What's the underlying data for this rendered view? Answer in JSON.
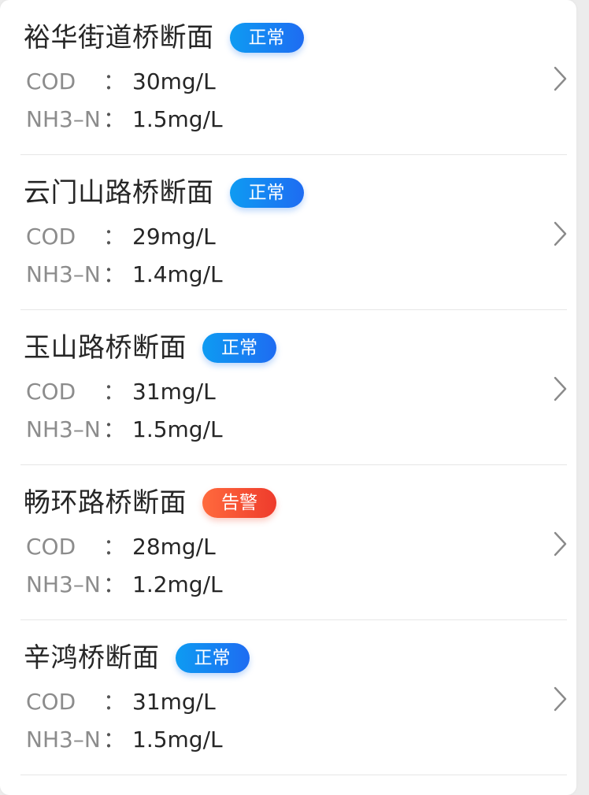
{
  "stations": [
    {
      "name": "裕华街道桥断面",
      "status": "正常",
      "status_type": "normal",
      "metrics": [
        {
          "label": "COD",
          "colon": "：",
          "value": "30mg/L"
        },
        {
          "label": "NH3–N",
          "colon": "：",
          "value": "1.5mg/L"
        }
      ]
    },
    {
      "name": "云门山路桥断面",
      "status": "正常",
      "status_type": "normal",
      "metrics": [
        {
          "label": "COD",
          "colon": "：",
          "value": "29mg/L"
        },
        {
          "label": "NH3–N",
          "colon": "：",
          "value": "1.4mg/L"
        }
      ]
    },
    {
      "name": "玉山路桥断面",
      "status": "正常",
      "status_type": "normal",
      "metrics": [
        {
          "label": "COD",
          "colon": "：",
          "value": "31mg/L"
        },
        {
          "label": "NH3–N",
          "colon": "：",
          "value": "1.5mg/L"
        }
      ]
    },
    {
      "name": "畅环路桥断面",
      "status": "告警",
      "status_type": "alarm",
      "metrics": [
        {
          "label": "COD",
          "colon": "：",
          "value": "28mg/L"
        },
        {
          "label": "NH3–N",
          "colon": "：",
          "value": "1.2mg/L"
        }
      ]
    },
    {
      "name": "辛鸿桥断面",
      "status": "正常",
      "status_type": "normal",
      "metrics": [
        {
          "label": "COD",
          "colon": "：",
          "value": "31mg/L"
        },
        {
          "label": "NH3–N",
          "colon": "：",
          "value": "1.5mg/L"
        }
      ]
    }
  ],
  "icons": {
    "row_action": "chevron-right-icon"
  },
  "colors": {
    "normal_start": "#0e9bf2",
    "normal_end": "#1e6cf2",
    "alarm_start": "#ff6a3d",
    "alarm_end": "#ee3b2c"
  }
}
